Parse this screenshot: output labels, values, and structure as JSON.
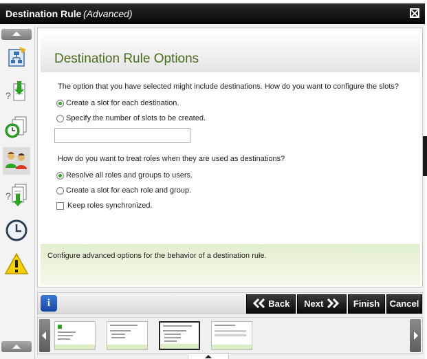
{
  "window": {
    "title": "Destination Rule",
    "mode": "(Advanced)"
  },
  "sidebar": {
    "icons": [
      "process-map-icon",
      "process-download-icon",
      "events-clock-icon",
      "users-roles-icon",
      "documents-download-icon",
      "clock-icon",
      "warning-icon"
    ],
    "selected_index": 3
  },
  "main": {
    "heading": "Destination Rule Options",
    "slots_question": "The option that you have selected might include destinations. How do you want to configure the slots?",
    "slot_options": [
      {
        "label": "Create a slot for each destination.",
        "selected": true
      },
      {
        "label": "Specify the number of slots to be created.",
        "selected": false
      }
    ],
    "slots_input_value": "",
    "roles_question": "How do you want to treat roles when they are used as destinations?",
    "role_options": [
      {
        "label": "Resolve all roles and groups to users.",
        "selected": true
      },
      {
        "label": "Create a slot for each role and group.",
        "selected": false
      }
    ],
    "keep_synced_label": "Keep roles synchronized.",
    "keep_synced_checked": false,
    "description": "Configure advanced options for the behavior of a destination rule."
  },
  "buttons": {
    "info": "i",
    "back": "Back",
    "next": "Next",
    "finish": "Finish",
    "cancel": "Cancel"
  },
  "colors": {
    "heading": "#4b6e1b",
    "radio_selected": "#2aa520",
    "description_bg": "#e1efcd",
    "titlebar": "#050505"
  }
}
